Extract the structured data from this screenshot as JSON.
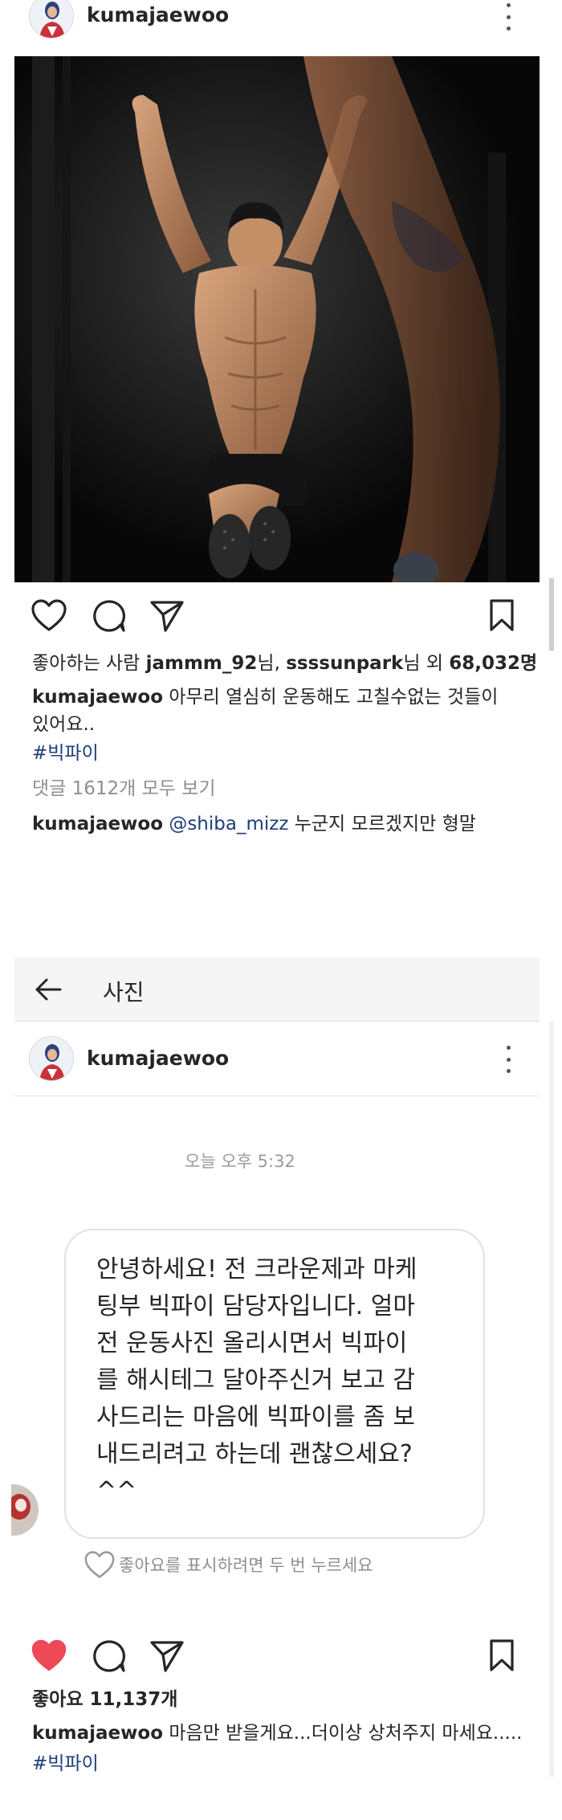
{
  "post1": {
    "username": "kumajaewoo",
    "likes_prefix": "좋아하는 사람 ",
    "likes_user1": "jammm_92",
    "likes_mid1": "님, ",
    "likes_user2": "ssssunpark",
    "likes_mid2": "님 외 ",
    "likes_count": "68,032명",
    "caption_user": "kumajaewoo",
    "caption_line1": " 아무리 열심히 운동해도 고칠수없는 것들이",
    "caption_line2": "있어요..",
    "hashtag": "#빅파이",
    "view_comments": "댓글 1612개 모두 보기",
    "comment_user": "kumajaewoo",
    "comment_mention": " @shiba_mizz",
    "comment_text": " 누군지 모르겠지만 형말"
  },
  "photo_view": {
    "back_icon": "arrow-left-icon",
    "title": "사진",
    "username": "kumajaewoo"
  },
  "dm": {
    "timestamp": "오늘 오후 5:32",
    "message_lines": [
      "안녕하세요! 전 크라운제과 마케",
      "팅부 빅파이 담당자입니다. 얼마",
      "전 운동사진 올리시면서 빅파이",
      "를 해시테그 달아주신거 보고 감",
      "사드리는 마음에 빅파이를 좀 보",
      "내드리려고 하는데 괜찮으세요?",
      "^^"
    ],
    "like_hint": "좋아요를 표시하려면 두 번 누르세요"
  },
  "post2": {
    "likes": "좋아요 11,137개",
    "caption_user": "kumajaewoo",
    "caption_text": " 마음만 받을게요...더이상 상처주지 마세요.....",
    "hashtag": "#빅파이",
    "like_color": "#ed4956"
  },
  "icons": {
    "post1_actions": [
      "heart-outline-icon",
      "comment-icon",
      "send-icon",
      "bookmark-icon"
    ],
    "post2_actions": [
      "heart-filled-icon",
      "comment-icon",
      "send-icon",
      "bookmark-icon"
    ]
  }
}
